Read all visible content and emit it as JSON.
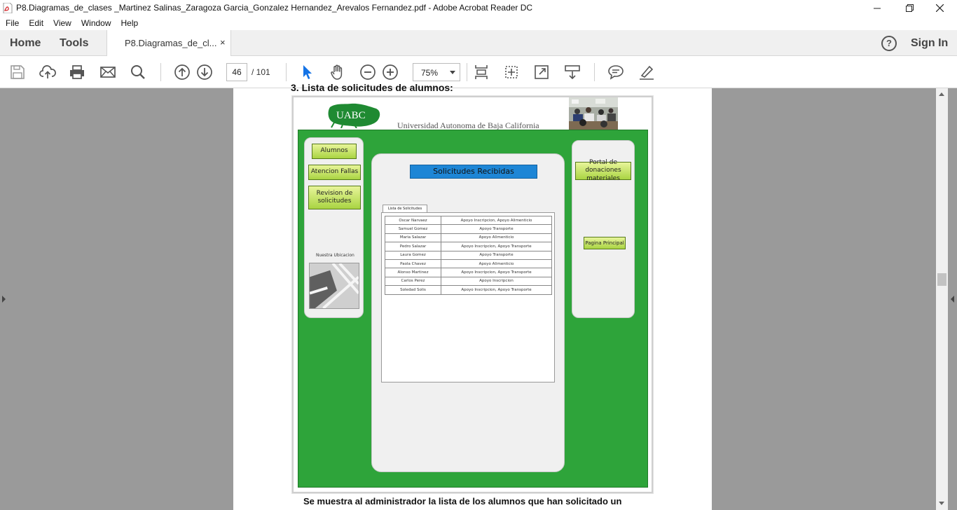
{
  "window": {
    "title": "P8.Diagramas_de_clases _Martinez Salinas_Zaragoza Garcia_Gonzalez Hernandez_Arevalos Fernandez.pdf - Adobe Acrobat Reader DC"
  },
  "menu": [
    "File",
    "Edit",
    "View",
    "Window",
    "Help"
  ],
  "tabs": {
    "home": "Home",
    "tools": "Tools",
    "document": "P8.Diagramas_de_cl...",
    "close": "×",
    "help": "?",
    "sign_in": "Sign In"
  },
  "toolbar": {
    "page_current": "46",
    "page_total": "/  101",
    "zoom": "75%"
  },
  "document": {
    "heading_partial": "3. Lista de solicitudes de alumnos:",
    "caption": "Se muestra al administrador la lista de los alumnos que han solicitado un"
  },
  "mockup": {
    "logo_text": "UABC",
    "university": "Universidad Autonoma de Baja California",
    "left_buttons": [
      "Alumnos",
      "Atencion Fallas",
      "Revision de solicitudes"
    ],
    "location_label": "Nuestra Ubicacion",
    "header": "Solicitudes Recibidas",
    "list_tab": "Lista de Solicitudes",
    "rows": [
      {
        "name": "Oscar Narvaez",
        "request": "Apoyo Inscripcion, Apoyo Alimenticio"
      },
      {
        "name": "Samuel Gomez",
        "request": "Apoyo Transporte"
      },
      {
        "name": "Maria Salazar",
        "request": "Apoyo Alimenticio"
      },
      {
        "name": "Pedro Salazar",
        "request": "Apoyo Inscripcion, Apoyo Transporte"
      },
      {
        "name": "Laura Gomez",
        "request": "Apoyo Transporte"
      },
      {
        "name": "Paola Chavez",
        "request": "Apoyo Alimenticio"
      },
      {
        "name": "Alonso Martinez",
        "request": "Apoyo Inscripcion, Apoyo Transporte"
      },
      {
        "name": "Carlos Perez",
        "request": "Apoyo Inscripcion"
      },
      {
        "name": "Soledad Solis",
        "request": "Apoyo Inscripcion, Apoyo Transporte"
      }
    ],
    "right_buttons": [
      "Portal de donaciones materiales",
      "Pagina Principal"
    ]
  }
}
